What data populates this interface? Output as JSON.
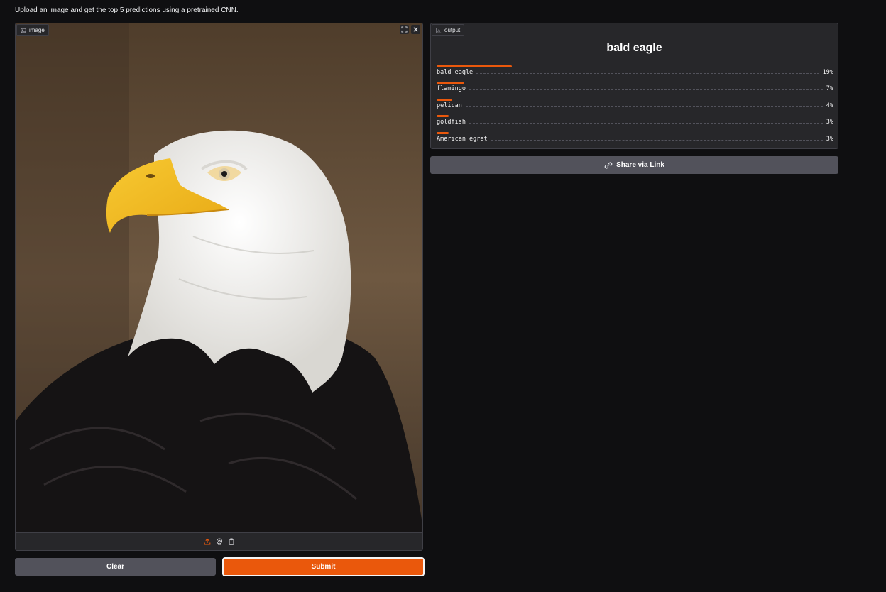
{
  "description": "Upload an image and get the top 5 predictions using a pretrained CNN.",
  "image_panel": {
    "label": "image",
    "label_icon": "image-icon",
    "fullscreen_icon": "fullscreen-icon",
    "close_icon": "close-icon",
    "toolbar_icons": [
      "upload-icon",
      "webcam-icon",
      "clipboard-icon"
    ]
  },
  "buttons": {
    "clear": "Clear",
    "submit": "Submit"
  },
  "output_panel": {
    "label": "output",
    "label_icon": "chart-icon",
    "top_label": "bald eagle",
    "confidences": [
      {
        "label": "bald eagle",
        "value": "19%",
        "fraction": 0.19
      },
      {
        "label": "flamingo",
        "value": "7%",
        "fraction": 0.07
      },
      {
        "label": "pelican",
        "value": "4%",
        "fraction": 0.04
      },
      {
        "label": "goldfish",
        "value": "3%",
        "fraction": 0.03
      },
      {
        "label": "American egret",
        "value": "3%",
        "fraction": 0.03
      }
    ]
  },
  "share": {
    "label": "Share via Link",
    "icon": "link-icon"
  },
  "colors": {
    "accent": "#ea580c",
    "background": "#0f0f11",
    "panel": "#27272a",
    "button": "#52525b"
  }
}
